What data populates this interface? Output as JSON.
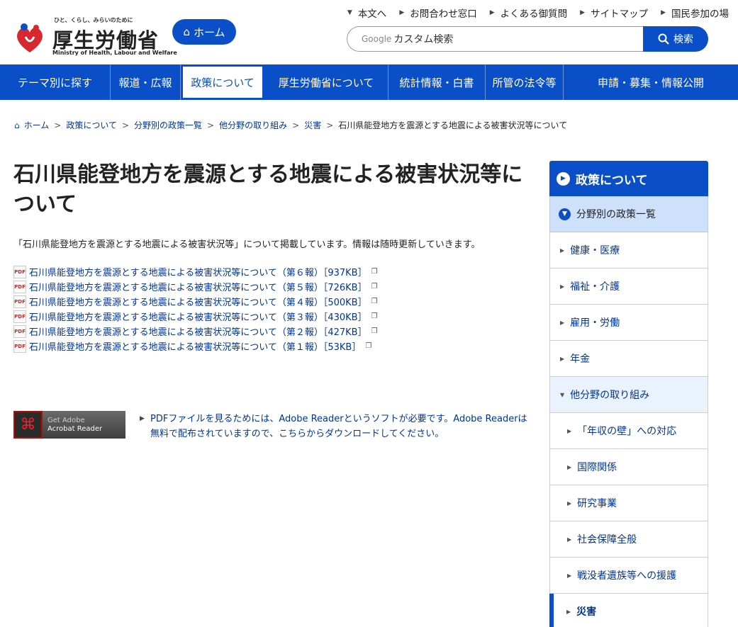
{
  "header": {
    "logo_tagline": "ひと、くらし、みらいのために",
    "logo_name": "厚生労働省",
    "logo_en": "Ministry of Health, Labour and Welfare",
    "home_label": "ホーム",
    "util_links": [
      "本文へ",
      "お問合わせ窓口",
      "よくある御質問",
      "サイトマップ",
      "国民参加の場"
    ],
    "search_brand": "Google",
    "search_placeholder": "カスタム検索",
    "search_button": "検索"
  },
  "gnav": [
    "テーマ別に探す",
    "報道・広報",
    "政策について",
    "厚生労働省について",
    "統計情報・白書",
    "所管の法令等",
    "申請・募集・情報公開"
  ],
  "breadcrumb": [
    "ホーム",
    "政策について",
    "分野別の政策一覧",
    "他分野の取り組み",
    "災害",
    "石川県能登地方を震源とする地震による被害状況等について"
  ],
  "main": {
    "title": "石川県能登地方を震源とする地震による被害状況等について",
    "lead": "「石川県能登地方を震源とする地震による被害状況等」について掲載しています。情報は随時更新していきます。",
    "pdf_icon_text": "PDF",
    "pdfs": [
      "石川県能登地方を震源とする地震による被害状況等について（第６報）［937KB］",
      "石川県能登地方を震源とする地震による被害状況等について（第５報）［726KB］",
      "石川県能登地方を震源とする地震による被害状況等について（第４報）［500KB］",
      "石川県能登地方を震源とする地震による被害状況等について（第３報）［430KB］",
      "石川県能登地方を震源とする地震による被害状況等について（第２報）［427KB］",
      "石川県能登地方を震源とする地震による被害状況等について（第１報）［53KB］"
    ],
    "adobe_get": "Get Adobe",
    "adobe_product": "Acrobat Reader",
    "adobe_note": "PDFファイルを見るためには、Adobe Readerというソフトが必要です。Adobe Readerは無料で配布されていますので、こちらからダウンロードしてください。"
  },
  "side": {
    "heading": "政策について",
    "sub": "分野別の政策一覧",
    "items": [
      "健康・医療",
      "福祉・介護",
      "雇用・労働",
      "年金",
      "他分野の取り組み"
    ],
    "children": [
      "「年収の壁」への対応",
      "国際関係",
      "研究事業",
      "社会保障全般",
      "戦没者遺族等への援護",
      "災害"
    ]
  },
  "colors": {
    "brand_blue": "#0a4fc7",
    "link": "#003399",
    "sub_bg": "#cfe0fb"
  }
}
